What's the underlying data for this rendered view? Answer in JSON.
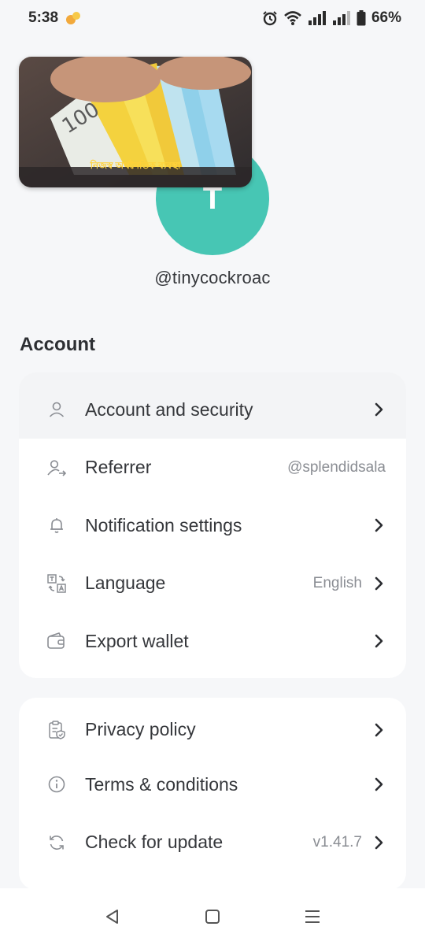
{
  "status_bar": {
    "time": "5:38",
    "battery": "66%",
    "icons": [
      "app-notification-icon",
      "alarm-icon",
      "wifi-icon",
      "signal-icon",
      "signal-icon",
      "battery-icon"
    ]
  },
  "profile": {
    "avatar_initial": "T",
    "avatar_color": "#47c6b4",
    "banner_caption": "নিজস্ব অর্থনৈতিক ব্যবস্থা",
    "username": "@tinycockroac"
  },
  "section": {
    "title": "Account"
  },
  "account_items": [
    {
      "label": "Account and security",
      "icon": "user-icon"
    },
    {
      "label": "Referrer",
      "icon": "user-arrow-icon",
      "value": "@splendidsala"
    },
    {
      "label": "Notification settings",
      "icon": "bell-icon"
    },
    {
      "label": "Language",
      "icon": "translate-icon",
      "value": "English"
    },
    {
      "label": "Export wallet",
      "icon": "wallet-icon"
    }
  ],
  "about_items": [
    {
      "label": "Privacy policy",
      "icon": "clipboard-shield-icon"
    },
    {
      "label": "Terms & conditions",
      "icon": "info-icon"
    },
    {
      "label": "Check for update",
      "icon": "refresh-icon",
      "value": "v1.41.7"
    }
  ],
  "nav": {
    "icons": [
      "back-icon",
      "home-icon",
      "menu-icon"
    ]
  }
}
